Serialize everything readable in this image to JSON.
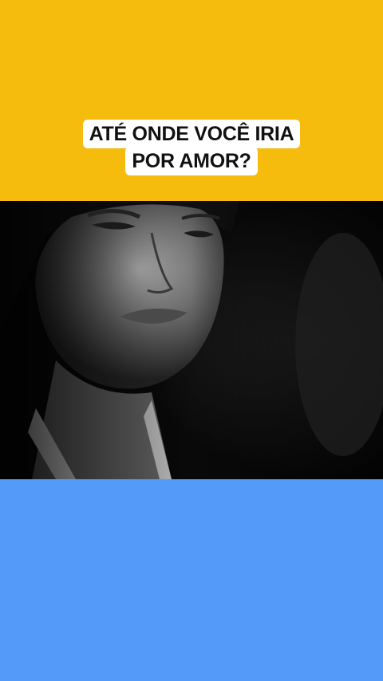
{
  "caption": {
    "line1": "ATÉ ONDE VOCÊ IRIA",
    "line2": "POR AMOR?"
  },
  "colors": {
    "top_band": "#F5BC0E",
    "bottom_band": "#549BF9",
    "caption_bg": "#FFFFFF",
    "caption_text": "#111111"
  },
  "video": {
    "content": "black-and-white-portrait-frame"
  }
}
